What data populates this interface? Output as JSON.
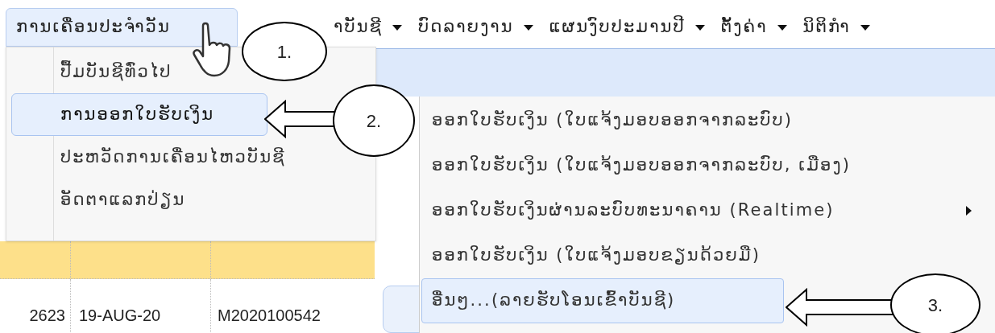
{
  "menubar": [
    {
      "label": "ການເຄື່ອນປະຈຳວັນ",
      "selected": true,
      "caret": false
    },
    {
      "label": "າບັນຊີ",
      "selected": false,
      "caret": true
    },
    {
      "label": "ບົດລາຍງານ",
      "selected": false,
      "caret": true
    },
    {
      "label": "ແຜນງົບປະມານປີ",
      "selected": false,
      "caret": true
    },
    {
      "label": "ຕັ້ງຄ່າ",
      "selected": false,
      "caret": true
    },
    {
      "label": "ນິຕິກຳ",
      "selected": false,
      "caret": true
    }
  ],
  "menu": {
    "items": [
      {
        "label": "ປື້ມບັນຊີທົ່ວໄປ",
        "selected": false
      },
      {
        "label": "ການອອກໃບຮັບເງິນ",
        "selected": true
      },
      {
        "label": "ປະຫວັດການເຄື່ອນໄຫວບັນຊີ",
        "selected": false
      },
      {
        "label": "ອັດຕາແລກປ່ຽນ",
        "selected": false
      }
    ]
  },
  "submenu": {
    "items": [
      {
        "label": "ອອກໃບຮັບເງິນ (ໃບແຈ້ງມອບອອກຈາກລະບົບ)",
        "selected": false,
        "has_submenu": false
      },
      {
        "label": "ອອກໃບຮັບເງິນ (ໃບແຈ້ງມອບອອກຈາກລະບົບ, ເມືອງ)",
        "selected": false,
        "has_submenu": false
      },
      {
        "label": "ອອກໃບຮັບເງິນຜ່ານລະບົບທະນາຄານ (Realtime)",
        "selected": false,
        "has_submenu": true
      },
      {
        "label": "ອອກໃບຮັບເງິນ (ໃບແຈ້ງມອບຂຽນດ້ວຍມື)",
        "selected": false,
        "has_submenu": false
      },
      {
        "label": "ອື່ນໆ...(ລາຍຮັບໂອນເຂົ້າບັນຊີ)",
        "selected": true,
        "has_submenu": false
      }
    ]
  },
  "table": {
    "rows": [
      [
        "2623",
        "19-AUG-20",
        "M2020100542"
      ]
    ]
  },
  "callouts": [
    "1.",
    "2.",
    "3."
  ]
}
